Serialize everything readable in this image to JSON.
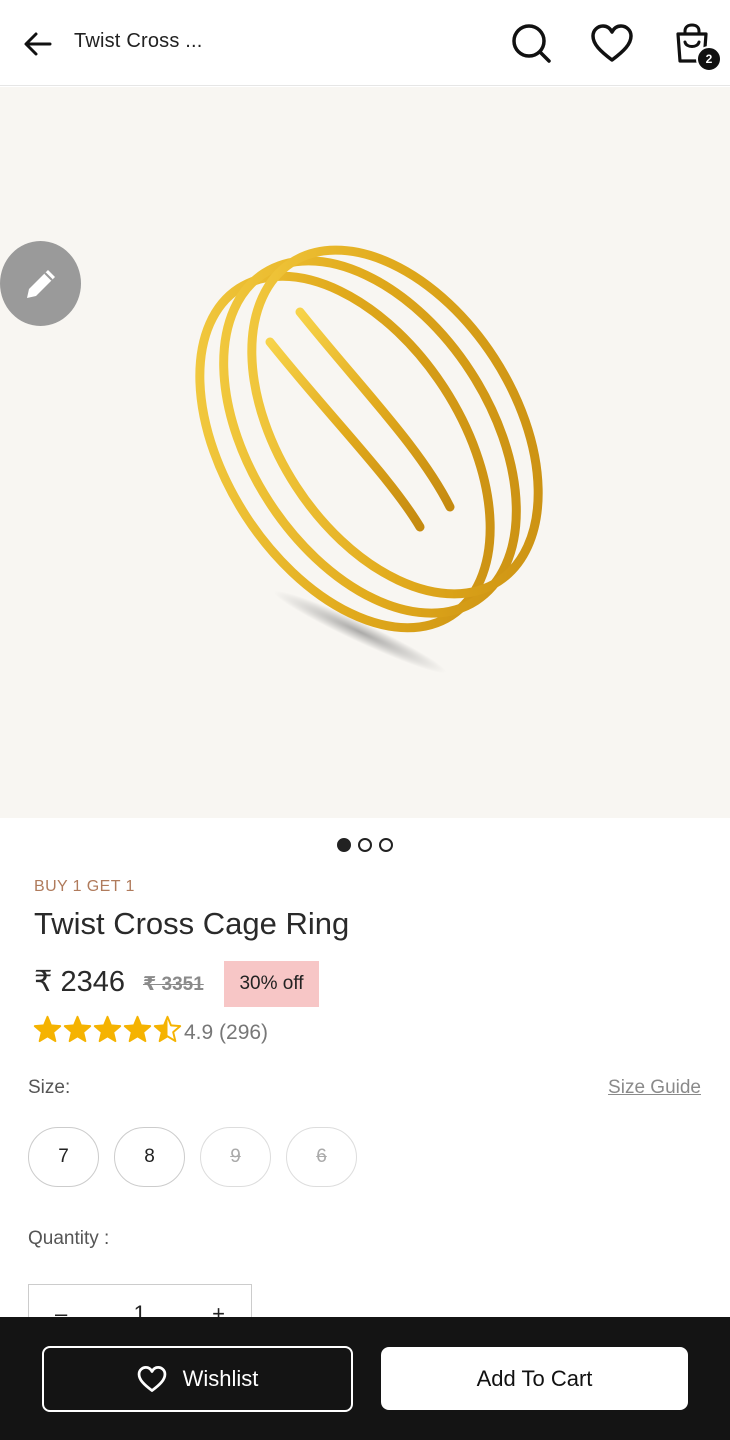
{
  "header": {
    "title": "Twist Cross ...",
    "cart_count": "2",
    "icons": [
      "back-arrow-icon",
      "search-icon",
      "heart-icon",
      "shopping-bag-icon"
    ]
  },
  "gallery": {
    "slide_count": 3,
    "active_slide": 1
  },
  "product": {
    "promo": "BUY 1 GET 1",
    "name": "Twist Cross Cage Ring",
    "price": "₹ 2346",
    "old_price": "₹ 3351",
    "discount": "30% off",
    "rating_value": 4.5,
    "rating_text": "4.9 (296)"
  },
  "size": {
    "label": "Size:",
    "guide_label": "Size Guide",
    "options": [
      {
        "label": "7",
        "available": true
      },
      {
        "label": "8",
        "available": true
      },
      {
        "label": "9",
        "available": false
      },
      {
        "label": "6",
        "available": false
      }
    ]
  },
  "quantity": {
    "label": "Quantity :",
    "minus": "–",
    "value": "1",
    "plus": "+"
  },
  "actions": {
    "wishlist_label": "Wishlist",
    "add_to_cart_label": "Add To Cart"
  },
  "colors": {
    "accent_promo": "#b07b5c",
    "discount_bg": "#f7c6c6",
    "star": "#f5b301",
    "bottom_bar": "#141414"
  }
}
